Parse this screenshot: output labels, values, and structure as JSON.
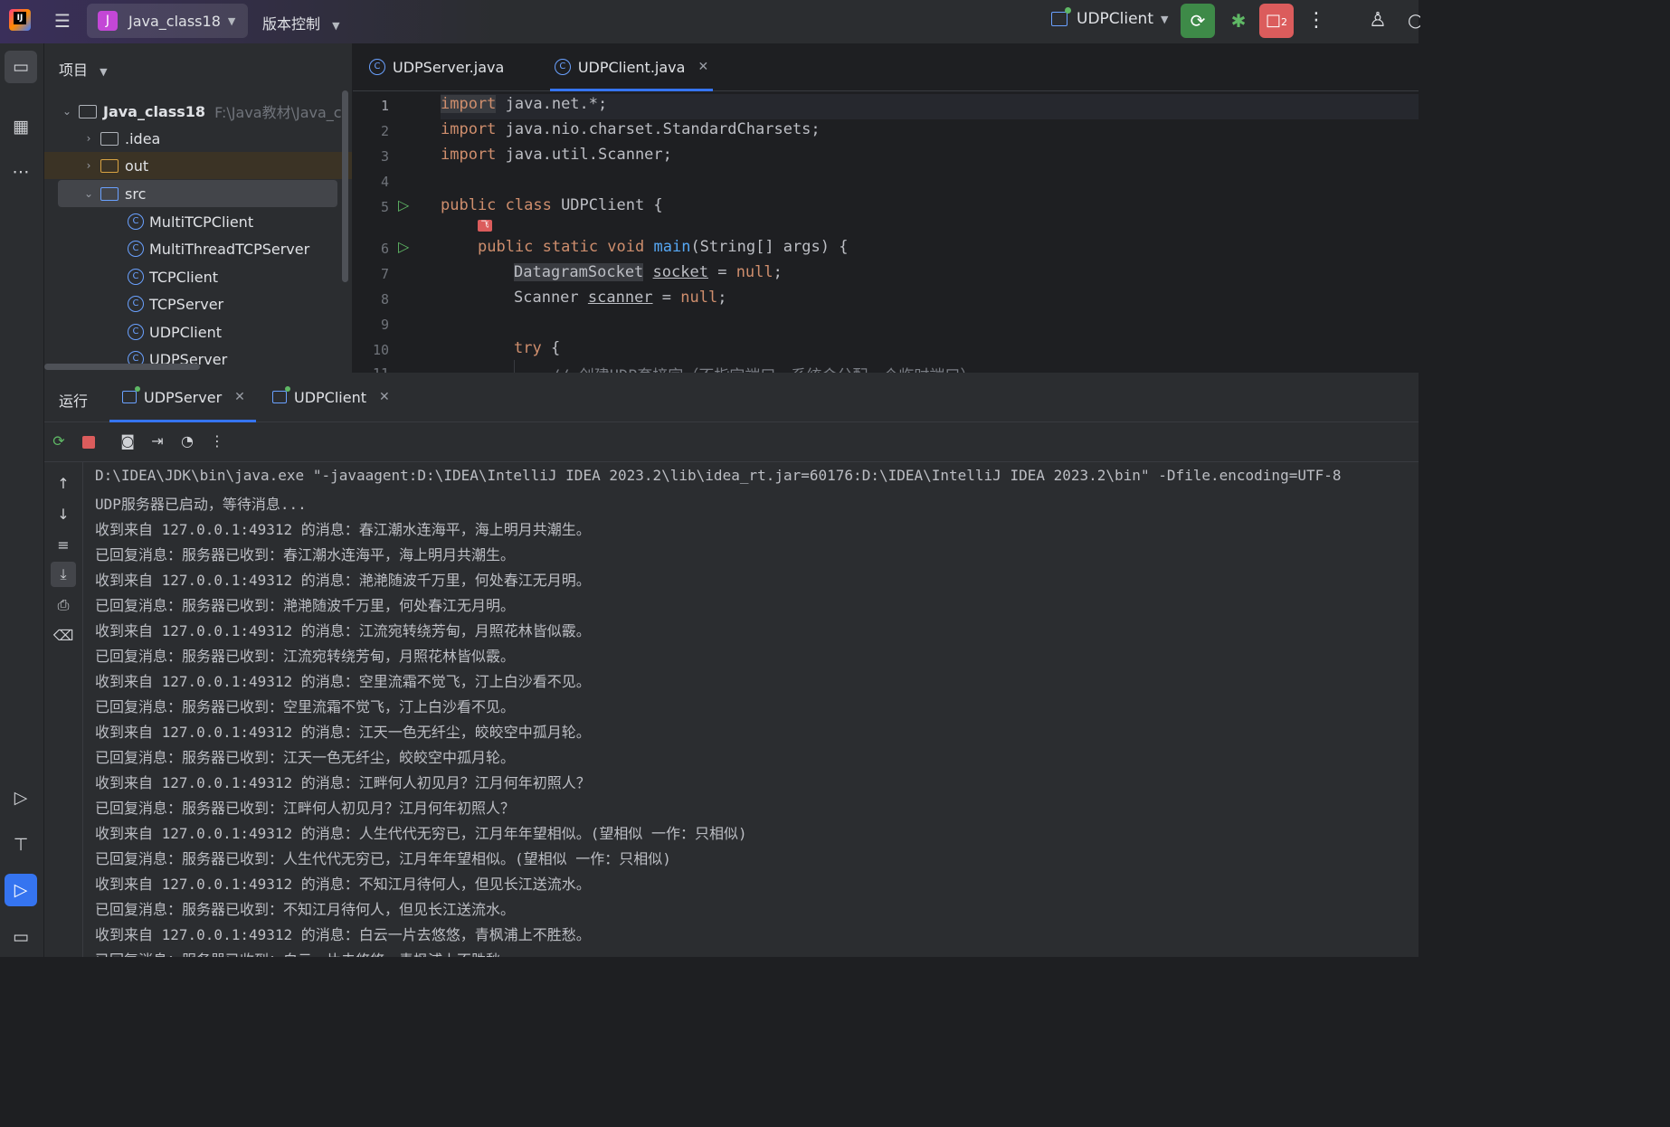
{
  "titlebar": {
    "project_badge": "J",
    "project_name": "Java_class18",
    "vcs_label": "版本控制",
    "run_config": "UDPClient",
    "stop_count": "2"
  },
  "project_pane": {
    "header": "项目",
    "root_name": "Java_class18",
    "root_path": "F:\\Java教材\\Java_cl",
    "items": [
      {
        "label": ".idea"
      },
      {
        "label": "out"
      },
      {
        "label": "src"
      },
      {
        "label": "MultiTCPClient"
      },
      {
        "label": "MultiThreadTCPServer"
      },
      {
        "label": "TCPClient"
      },
      {
        "label": "TCPServer"
      },
      {
        "label": "UDPClient"
      },
      {
        "label": "UDPServer"
      }
    ]
  },
  "editor": {
    "tabs": [
      {
        "label": "UDPServer.java"
      },
      {
        "label": "UDPClient.java"
      }
    ],
    "line_numbers": [
      "1",
      "2",
      "3",
      "4",
      "5",
      "6",
      "7",
      "8",
      "9",
      "10",
      "11"
    ],
    "code": {
      "l1_kw": "import",
      "l1_rest": " java.net.*;",
      "l2_kw": "import",
      "l2_rest": " java.nio.charset.StandardCharsets;",
      "l3_kw": "import",
      "l3_rest": " java.util.Scanner;",
      "l5_kw": "public class",
      "l5_rest": " UDPClient {",
      "l6_kw": "public static void",
      "l6_fn": "main",
      "l6_rest": "(String[] args) {",
      "l7_type": "DatagramSocket",
      "l7_var": "socket",
      "l7_eq": " = ",
      "l7_null": "null",
      "l7_end": ";",
      "l8_type": "Scanner ",
      "l8_var": "scanner",
      "l8_eq": " = ",
      "l8_null": "null",
      "l8_end": ";",
      "l10_kw": "try",
      "l10_rest": " {",
      "l11": "// 创建UDP套接字（不指定端口，系统会分配一个临时端口）"
    }
  },
  "run_panel": {
    "label": "运行",
    "tabs": [
      {
        "label": "UDPServer"
      },
      {
        "label": "UDPClient"
      }
    ],
    "console_lines": [
      "D:\\IDEA\\JDK\\bin\\java.exe \"-javaagent:D:\\IDEA\\IntelliJ IDEA 2023.2\\lib\\idea_rt.jar=60176:D:\\IDEA\\IntelliJ IDEA 2023.2\\bin\" -Dfile.encoding=UTF-8",
      "UDP服务器已启动，等待消息...",
      "收到来自 127.0.0.1:49312 的消息：春江潮水连海平，海上明月共潮生。",
      "已回复消息：服务器已收到：春江潮水连海平，海上明月共潮生。",
      "收到来自 127.0.0.1:49312 的消息：滟滟随波千万里，何处春江无月明。",
      "已回复消息：服务器已收到：滟滟随波千万里，何处春江无月明。",
      "收到来自 127.0.0.1:49312 的消息：江流宛转绕芳甸，月照花林皆似霰。",
      "已回复消息：服务器已收到：江流宛转绕芳甸，月照花林皆似霰。",
      "收到来自 127.0.0.1:49312 的消息：空里流霜不觉飞，汀上白沙看不见。",
      "已回复消息：服务器已收到：空里流霜不觉飞，汀上白沙看不见。",
      "收到来自 127.0.0.1:49312 的消息：江天一色无纤尘，皎皎空中孤月轮。",
      "已回复消息：服务器已收到：江天一色无纤尘，皎皎空中孤月轮。",
      "收到来自 127.0.0.1:49312 的消息：江畔何人初见月？江月何年初照人？",
      "已回复消息：服务器已收到：江畔何人初见月？江月何年初照人？",
      "收到来自 127.0.0.1:49312 的消息：人生代代无穷已，江月年年望相似。(望相似 一作：只相似)",
      "已回复消息：服务器已收到：人生代代无穷已，江月年年望相似。(望相似 一作：只相似)",
      "收到来自 127.0.0.1:49312 的消息：不知江月待何人，但见长江送流水。",
      "已回复消息：服务器已收到：不知江月待何人，但见长江送流水。",
      "收到来自 127.0.0.1:49312 的消息：白云一片去悠悠，青枫浦上不胜愁。",
      "已回复消息：服务器已收到：白云一片去悠悠，青枫浦上不胜愁。"
    ]
  }
}
